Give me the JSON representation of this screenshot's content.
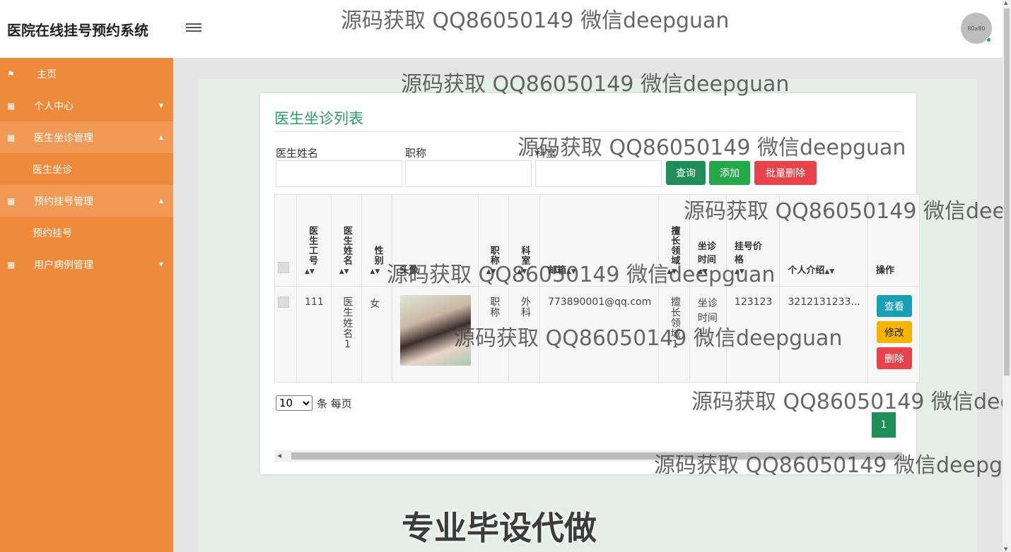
{
  "header": {
    "title": "医院在线挂号预约系统",
    "avatar_text": "80x80"
  },
  "sidebar": {
    "items": [
      {
        "label": "主页",
        "icon": "flag-icon"
      },
      {
        "label": "个人中心",
        "icon": "grid-icon"
      },
      {
        "label": "医生坐诊管理",
        "icon": "grid-icon"
      },
      {
        "label": "医生坐诊"
      },
      {
        "label": "预约挂号管理",
        "icon": "grid-icon"
      },
      {
        "label": "预约挂号"
      },
      {
        "label": "用户病例管理",
        "icon": "grid-icon"
      }
    ]
  },
  "main": {
    "title": "医生坐诊列表",
    "filters": {
      "name_label": "医生姓名",
      "title_label": "职称",
      "dept_label": "科室",
      "name_value": "",
      "title_value": "",
      "dept_value": ""
    },
    "buttons": {
      "query": "查询",
      "add": "添加",
      "batch_delete": "批量删除"
    },
    "table": {
      "headers": [
        "医生工号",
        "医生姓名",
        "性别",
        "头像",
        "职称",
        "科室",
        "邮箱",
        "擅长领域",
        "坐诊时间",
        "挂号价格",
        "个人介绍",
        "操作"
      ],
      "rows": [
        {
          "id": "111",
          "name": "医生姓名1",
          "gender": "女",
          "title": "职称",
          "dept": "外科",
          "email": "773890001@qq.com",
          "specialty": "擅长领域1",
          "time": "坐诊时间1",
          "price": "123123",
          "intro": "3212131233..."
        }
      ],
      "actions": {
        "view": "查看",
        "edit": "修改",
        "delete": "删除"
      }
    },
    "pagination": {
      "page_size": "10",
      "per_page_text": "条 每页",
      "current_page": "1"
    }
  },
  "watermark": {
    "text": "源码获取 QQ86050149 微信deepguan",
    "banner": "专业毕设代做"
  },
  "colors": {
    "sidebar": "#ee8a3b",
    "primary": "#1f8f57",
    "danger": "#e8434a",
    "title": "#28a06a"
  }
}
